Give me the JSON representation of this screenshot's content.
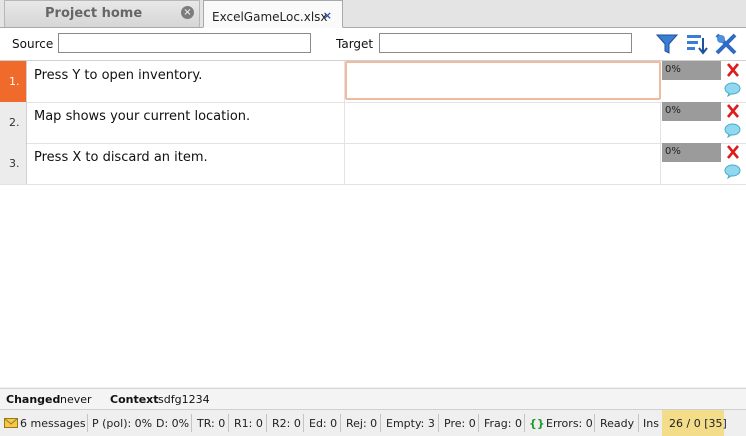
{
  "tabs": {
    "home_label": "Project home",
    "file_label": "ExcelGameLoc.xlsx"
  },
  "toolbar": {
    "source_label": "Source",
    "target_label": "Target",
    "source_value": "",
    "target_value": ""
  },
  "rows": [
    {
      "num": "1.",
      "source": "Press Y to open inventory.",
      "target": "",
      "progress": "0%"
    },
    {
      "num": "2.",
      "source": "Map shows your current location.",
      "target": "",
      "progress": "0%"
    },
    {
      "num": "3.",
      "source": "Press X to discard an item.",
      "target": "",
      "progress": "0%"
    }
  ],
  "info": {
    "changed_label": "Changed",
    "changed_value": "never",
    "context_label": "Context",
    "context_value": "sdfg1234"
  },
  "status": {
    "messages": "6 messages",
    "pol": "P (pol): 0%",
    "d": "D: 0%",
    "tr": "TR: 0",
    "r1": "R1: 0",
    "r2": "R2: 0",
    "ed": "Ed: 0",
    "rej": "Rej: 0",
    "empty": "Empty: 3",
    "pre": "Pre: 0",
    "frag": "Frag: 0",
    "errors_icon_text": "{}",
    "errors": "Errors: 0",
    "ready": "Ready",
    "ins": "Ins",
    "position": "26 / 0 [35]"
  },
  "colors": {
    "active_row": "#ef6a2b",
    "position_highlight": "#f3dd8a",
    "delete": "#e01b1b",
    "comment": "#8fd8f0"
  }
}
